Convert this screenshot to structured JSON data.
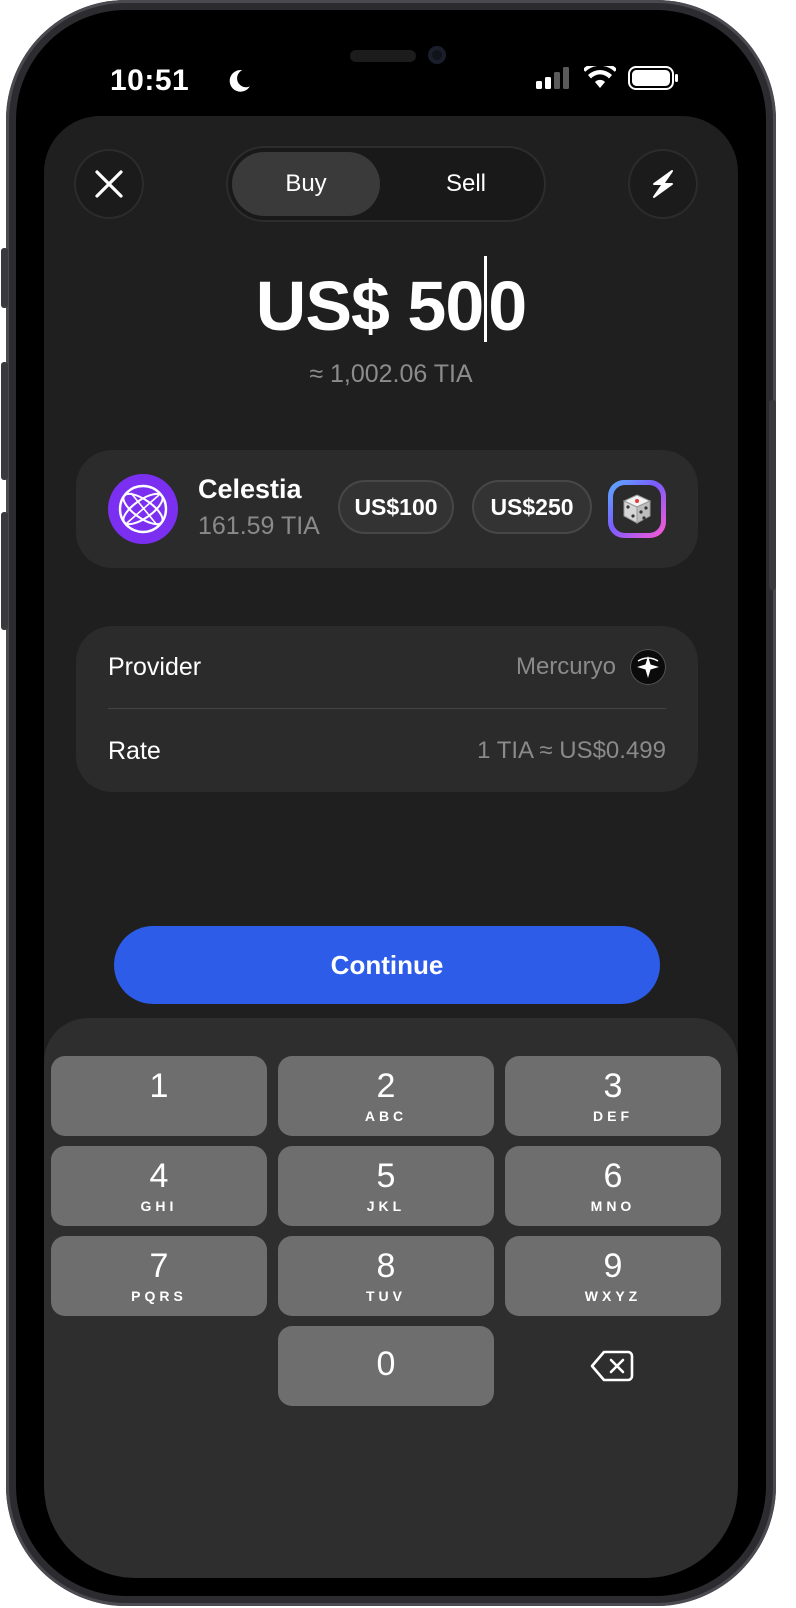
{
  "status_bar": {
    "time": "10:51"
  },
  "header": {
    "tabs": [
      {
        "label": "Buy",
        "active": true
      },
      {
        "label": "Sell",
        "active": false
      }
    ]
  },
  "amount": {
    "currency": "US$",
    "value_before_cursor": "50",
    "value_after_cursor": "0",
    "approx": "≈ 1,002.06 TIA"
  },
  "asset": {
    "name": "Celestia",
    "balance": "161.59 TIA",
    "presets": [
      "US$100",
      "US$250"
    ]
  },
  "info": {
    "provider_label": "Provider",
    "provider_value": "Mercuryo",
    "rate_label": "Rate",
    "rate_value": "1 TIA ≈ US$0.499"
  },
  "continue_label": "Continue",
  "keypad": {
    "keys": [
      {
        "num": "1",
        "letters": ""
      },
      {
        "num": "2",
        "letters": "ABC"
      },
      {
        "num": "3",
        "letters": "DEF"
      },
      {
        "num": "4",
        "letters": "GHI"
      },
      {
        "num": "5",
        "letters": "JKL"
      },
      {
        "num": "6",
        "letters": "MNO"
      },
      {
        "num": "7",
        "letters": "PQRS"
      },
      {
        "num": "8",
        "letters": "TUV"
      },
      {
        "num": "9",
        "letters": "WXYZ"
      },
      {
        "num": "0",
        "letters": ""
      }
    ]
  },
  "colors": {
    "accent": "#2c5ce8",
    "asset_logo": "#7b2ff0",
    "sheet_bg": "#1f1f1f",
    "card_bg": "#2b2b2b",
    "key_bg": "#6e6e6e"
  },
  "icons": {
    "close": "close-icon",
    "lightning": "lightning-icon",
    "dice": "dice-icon",
    "backspace": "backspace-icon"
  }
}
